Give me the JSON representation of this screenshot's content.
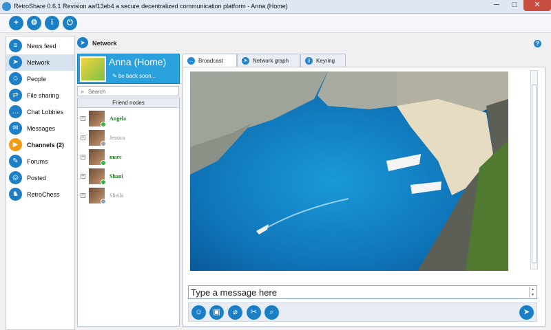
{
  "window": {
    "title": "RetroShare 0.6.1 Revision aaf13eb4 a secure decentralized communication platform - Anna (Home)",
    "min": "─",
    "max": "□",
    "close": "✕"
  },
  "toolbar": {
    "icons": [
      {
        "name": "add-friend-icon",
        "glyph": "+"
      },
      {
        "name": "settings-icon",
        "glyph": "⚙"
      },
      {
        "name": "info-icon",
        "glyph": "i"
      },
      {
        "name": "power-icon",
        "glyph": "⏻"
      }
    ]
  },
  "sidebar": {
    "items": [
      {
        "label": "News feed",
        "glyph": "≡",
        "selected": false,
        "bold": false
      },
      {
        "label": "Network",
        "glyph": "➤",
        "selected": true,
        "bold": false
      },
      {
        "label": "People",
        "glyph": "☺",
        "selected": false,
        "bold": false
      },
      {
        "label": "File sharing",
        "glyph": "⇄",
        "selected": false,
        "bold": false
      },
      {
        "label": "Chat Lobbies",
        "glyph": "…",
        "selected": false,
        "bold": false
      },
      {
        "label": "Messages",
        "glyph": "✉",
        "selected": false,
        "bold": false
      },
      {
        "label": "Channels (2)",
        "glyph": "▶",
        "selected": false,
        "bold": true
      },
      {
        "label": "Forums",
        "glyph": "✎",
        "selected": false,
        "bold": false
      },
      {
        "label": "Posted",
        "glyph": "◎",
        "selected": false,
        "bold": false
      },
      {
        "label": "RetroChess",
        "glyph": "♞",
        "selected": false,
        "bold": false
      }
    ]
  },
  "section": {
    "title": "Network",
    "help": "?"
  },
  "profile": {
    "name": "Anna (Home)",
    "status": "be back soon..."
  },
  "search": {
    "placeholder": "Search"
  },
  "friends": {
    "header": "Friend nodes",
    "list": [
      {
        "name": "Angela",
        "online": true
      },
      {
        "name": "Jessica",
        "online": false
      },
      {
        "name": "marc",
        "online": true
      },
      {
        "name": "Shani",
        "online": true
      },
      {
        "name": "Sheila",
        "online": false
      }
    ]
  },
  "tabs": [
    {
      "label": "Broadcast",
      "active": true
    },
    {
      "label": "Network graph",
      "active": false
    },
    {
      "label": "Keyring",
      "active": false
    }
  ],
  "chat": {
    "placeholder": "Type a message here",
    "actions": [
      {
        "name": "emoji-icon",
        "glyph": "☺"
      },
      {
        "name": "image-icon",
        "glyph": "▣"
      },
      {
        "name": "attach-icon",
        "glyph": "⌀"
      },
      {
        "name": "tools-icon",
        "glyph": "✂"
      },
      {
        "name": "search-text-icon",
        "glyph": "⌕"
      }
    ],
    "send_glyph": "➤"
  },
  "colors": {
    "accent": "#1b7fc6",
    "online": "#39b54a",
    "offline": "#9aa3ad",
    "online_text": "#1e7a1e",
    "offline_text": "#8a8a8a"
  }
}
